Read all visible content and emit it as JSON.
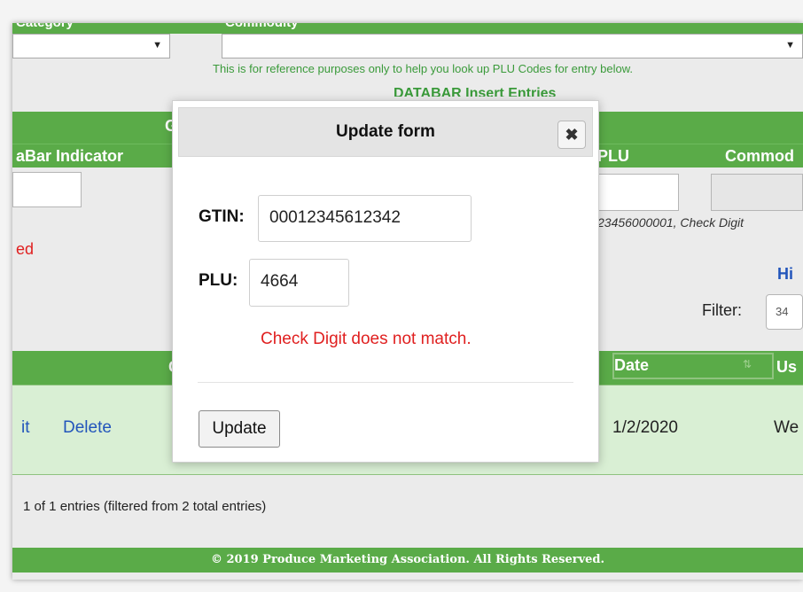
{
  "header": {
    "category_label": "Category",
    "commodity_label": "Commodity",
    "category_select_value": "",
    "commodity_select_value": "",
    "reference_note": "This is for reference purposes only to help you look up PLU Codes for entry below.",
    "section_title": "DATABAR Insert Entries"
  },
  "insert_form": {
    "group_header_partial": "G",
    "col_databar_indicator": "aBar Indicator",
    "col_plu": "PLU",
    "col_commodity": "Commod",
    "hint_text": "23456000001, Check Digit",
    "status_partial": "ed"
  },
  "history": {
    "title_partial": "Hi",
    "filter_label": "Filter:",
    "filter_value": "34"
  },
  "table": {
    "header_partial": "C",
    "date_header": "Date",
    "sort_icon": "sort-icon",
    "user_header_partial": "Us",
    "row": {
      "edit_link": "it",
      "delete_link": "Delete",
      "date": "1/2/2020",
      "user_partial": "We"
    },
    "summary": "1 of 1 entries (filtered from 2 total entries)"
  },
  "footer": {
    "text": "© 2019 Produce Marketing Association. All Rights Reserved."
  },
  "modal": {
    "title": "Update form",
    "close_icon": "close-icon",
    "gtin_label": "GTIN:",
    "gtin_value": "00012345612342",
    "plu_label": "PLU:",
    "plu_value": "4664",
    "error_message": "Check Digit does not match.",
    "update_button": "Update"
  },
  "colors": {
    "brand_green": "#5aab48",
    "row_green": "#d9efd4",
    "error_red": "#e02020",
    "link_blue": "#2255bb"
  }
}
